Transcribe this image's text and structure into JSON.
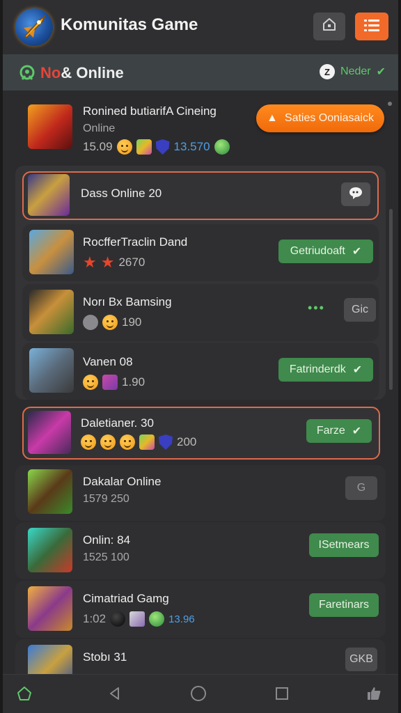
{
  "header": {
    "title": "Komunitas Game",
    "logo_icon": "rocket-logo-icon",
    "buttons": [
      {
        "name": "notification-button",
        "icon": "bell-icon"
      },
      {
        "name": "menu-button",
        "icon": "list-menu-icon"
      }
    ]
  },
  "status": {
    "title_part1": "No",
    "title_part2": "& Online",
    "right_label": "Neder",
    "clock_glyph": "Z"
  },
  "colors": {
    "accent_orange": "#f26a2a",
    "highlight_border": "#e06a4c",
    "green_button": "#3f8a4c",
    "status_green": "#5ec86a",
    "offline_red": "#e6453a"
  },
  "rows": [
    {
      "name": "Ronined butiarifA Cineing",
      "sub": "Online",
      "meta_left": "15.09",
      "meta_right": "13.570",
      "action": "Saties Ooniasaick"
    },
    {
      "name": "Dass Online 20"
    },
    {
      "name": "RocfferTraclin Dand",
      "meta": "2670",
      "action": "Getriudoaft"
    },
    {
      "name": "Norı Bx Bamsing",
      "meta": "190",
      "action": "Gic"
    },
    {
      "name": "Vanen 08",
      "meta": "1.90",
      "action": "Fatrinderdk"
    },
    {
      "name": "Daletianer. 30",
      "meta": "200",
      "action": "Farze"
    },
    {
      "name": "Dakalar Online",
      "sub": "1579 250",
      "action": "G"
    },
    {
      "name": "Onlin: 84",
      "sub": "1525 100",
      "action": "ISetmears"
    },
    {
      "name": "Cimatriad Gamg",
      "meta_left": "1:02",
      "meta_right": "13.96",
      "action": "Faretinars"
    },
    {
      "name": "Stobı 31",
      "action": "GKB"
    }
  ],
  "bottom_nav": [
    {
      "name": "home",
      "icon": "home-icon"
    },
    {
      "name": "back",
      "icon": "back-triangle-icon"
    },
    {
      "name": "circle",
      "icon": "home-circle-icon"
    },
    {
      "name": "recents",
      "icon": "square-icon"
    },
    {
      "name": "like",
      "icon": "thumbs-up-icon"
    }
  ]
}
